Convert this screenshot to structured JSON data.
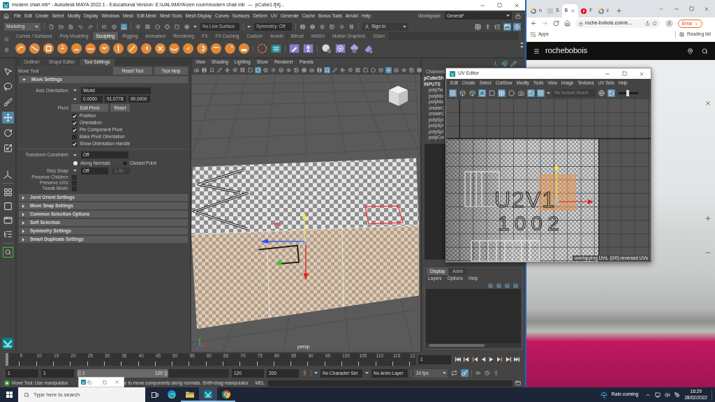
{
  "maya": {
    "title": "modern chair.mb* - Autodesk MAYA 2022.1 - Educational Version: E:\\UAL\\MAYA\\zen room\\modern chair.mb  ---  pCube1.f[4]...",
    "menus": [
      "File",
      "Edit",
      "Create",
      "Select",
      "Modify",
      "Display",
      "Windows",
      "Mesh",
      "Edit Mesh",
      "Mesh Tools",
      "Mesh Display",
      "Curves",
      "Surfaces",
      "Deform",
      "UV",
      "Generate",
      "Cache",
      "Bonus Tools",
      "Arnold",
      "Help"
    ],
    "workspace": {
      "label": "Workspace:",
      "value": "General*"
    },
    "status_line": {
      "mode": "Modeling",
      "select_modes": [
        {
          "selected": false
        },
        {
          "selected": false
        },
        {
          "selected": true
        }
      ],
      "live_surface": "No Live Surface",
      "symmetry": "Symmetry: Off",
      "sign_in": "Sign In",
      "panel_toggles": [
        {
          "on": false
        },
        {
          "on": false
        },
        {
          "on": false
        },
        {
          "on": true
        },
        {
          "on": true
        }
      ]
    },
    "shelf_tabs": [
      {
        "label": "Curves / Surfaces",
        "selected": false
      },
      {
        "label": "Poly Modeling",
        "selected": false
      },
      {
        "label": "Sculpting",
        "selected": true
      },
      {
        "label": "Rigging",
        "selected": false
      },
      {
        "label": "Animation",
        "selected": false
      },
      {
        "label": "Rendering",
        "selected": false
      },
      {
        "label": "FX",
        "selected": false
      },
      {
        "label": "FX Caching",
        "selected": false
      },
      {
        "label": "Custom",
        "selected": false
      },
      {
        "label": "Arnold",
        "selected": false
      },
      {
        "label": "Bifrost",
        "selected": false
      },
      {
        "label": "MASH",
        "selected": false
      },
      {
        "label": "Motion Graphics",
        "selected": false
      },
      {
        "label": "XGen",
        "selected": false
      }
    ],
    "toolbox": [
      {
        "selected": false
      },
      {
        "selected": false
      },
      {
        "selected": false
      },
      {
        "selected": true
      },
      {
        "selected": false
      },
      {
        "selected": false
      }
    ],
    "tool_settings": {
      "tabs": [
        {
          "label": "Outliner",
          "selected": false
        },
        {
          "label": "Shape Editor",
          "selected": false
        },
        {
          "label": "Tool Settings",
          "selected": true
        }
      ],
      "tool_name": "Move Tool",
      "buttons": [
        "Reset Tool",
        "Tool Help"
      ],
      "sections": [
        {
          "title": "Move Settings",
          "expanded": true
        },
        {
          "title": "Joint Orient Settings",
          "expanded": false
        },
        {
          "title": "Move Snap Settings",
          "expanded": false
        },
        {
          "title": "Common Selection Options",
          "expanded": false
        },
        {
          "title": "Soft Selection",
          "expanded": false
        },
        {
          "title": "Symmetry Settings",
          "expanded": false
        },
        {
          "title": "Smart Duplicate Settings",
          "expanded": false
        }
      ],
      "axis_orientation": {
        "label": "Axis Orientation:",
        "value": "World",
        "values": [
          "0.0000",
          "91.0778",
          "90.0000"
        ]
      },
      "pivot": {
        "label": "Pivot:",
        "buttons": [
          "Edit Pivot",
          "Reset"
        ]
      },
      "pivot_options": [
        {
          "label": "Position",
          "checked": true
        },
        {
          "label": "Orientation",
          "checked": true
        },
        {
          "label": "Pin Component Pivot",
          "checked": true
        },
        {
          "label": "Bake Pivot Orientation",
          "checked": false
        },
        {
          "label": "Show Orientation Handle",
          "checked": true
        }
      ],
      "transform_constraint": {
        "label": "Transform Constraint:",
        "value": "Off"
      },
      "constraint_modes": [
        {
          "label": "Along Normals",
          "selected": true
        },
        {
          "label": "Closest Point",
          "selected": false
        }
      ],
      "step_snap": {
        "label": "Step Snap:",
        "value": "Off",
        "amount": "1.00",
        "amount_disabled": true
      },
      "options": [
        {
          "label": "Preserve Children:",
          "checked": false
        },
        {
          "label": "Preserve UVs:",
          "checked": false
        },
        {
          "label": "Tweak Mode:",
          "checked": false
        }
      ]
    },
    "viewport": {
      "menus": [
        "View",
        "Shading",
        "Lighting",
        "Show",
        "Renderer",
        "Panels"
      ],
      "toolbar": [
        {
          "on": false
        },
        {
          "on": false
        },
        {
          "on": false
        },
        {
          "on": false
        },
        {
          "on": false
        },
        {
          "on": false
        },
        {
          "on": false
        },
        {
          "on": false
        },
        {
          "on": true
        },
        {
          "on": false
        },
        {
          "on": false
        },
        {
          "on": false
        },
        {
          "on": false
        },
        {
          "on": false
        },
        {
          "on": false
        },
        {
          "on": false
        },
        {
          "on": false
        },
        {
          "on": true
        },
        {
          "on": false
        },
        {
          "on": false
        },
        {
          "on": false
        },
        {
          "on": false
        },
        {
          "on": false
        },
        {
          "on": false
        },
        {
          "on": false
        },
        {
          "on": true
        },
        {
          "on": false
        },
        {
          "on": false
        },
        {
          "on": false
        },
        {
          "on": false
        }
      ],
      "camera": "persp"
    },
    "channel_box": {
      "title": "Channels",
      "items": [
        {
          "kind": "node",
          "label": "pCubeSh"
        },
        {
          "kind": "heading",
          "label": "INPUTS"
        },
        {
          "kind": "input",
          "label": "polyTw"
        },
        {
          "kind": "input",
          "label": "polyMa"
        },
        {
          "kind": "input",
          "label": "polyMa"
        },
        {
          "kind": "input",
          "label": "createC"
        },
        {
          "kind": "input",
          "label": "createC"
        },
        {
          "kind": "input",
          "label": "polySpl"
        },
        {
          "kind": "input",
          "label": "polySpl"
        },
        {
          "kind": "input",
          "label": "polySpl"
        },
        {
          "kind": "input",
          "label": "polyCut"
        }
      ]
    },
    "layer_editor": {
      "tabs": [
        {
          "label": "Display",
          "selected": true
        },
        {
          "label": "Anim",
          "selected": false
        }
      ],
      "menus": [
        "Layers",
        "Options",
        "Help"
      ]
    },
    "timeline": {
      "ticks": [
        "5",
        "10",
        "15",
        "20",
        "25",
        "30",
        "35",
        "40",
        "45",
        "50",
        "55",
        "60",
        "65",
        "70",
        "75",
        "80",
        "85",
        "90",
        "95",
        "100",
        "105",
        "110",
        "115",
        "12"
      ],
      "current_frame": "1"
    },
    "range": {
      "start": "1",
      "playback_start": "1",
      "slider": {
        "start": "1",
        "end": "120",
        "level": 0.6
      },
      "playback_end": "120",
      "end": "200",
      "character_set": "No Character Set",
      "anim_layer": "No Anim Layer",
      "fps": "24 fps",
      "playback_toggles": [
        {
          "on": false
        },
        {
          "on": true
        }
      ]
    },
    "help_line": {
      "parts": [
        "Move Tool: Use manipulator",
        "e to move components along normals. Shift+drag manipulator"
      ],
      "language": "MEL"
    }
  },
  "uv_editor": {
    "title": "UV Editor",
    "menus": [
      "Edit",
      "Create",
      "Select",
      "Cut/Sew",
      "Modify",
      "Tools",
      "View",
      "Image",
      "Textures",
      "UV Sets",
      "Help"
    ],
    "toolbar": [
      {
        "on": true
      },
      {
        "on": false
      },
      {
        "on": false
      },
      {
        "on": true
      },
      {
        "on": false
      },
      {
        "on": true
      },
      {
        "on": false
      },
      {
        "on": false
      },
      {
        "on": true
      },
      {
        "on": true
      }
    ],
    "texture": "No texture found",
    "display_toggles": [
      {
        "on": false
      },
      {
        "on": true
      }
    ],
    "slider": {
      "level": 0.45
    },
    "tile_labels": [
      "U2V1",
      "1002"
    ],
    "status": "overlapping UVs, (0/0) reversed UVs"
  },
  "browser": {
    "tabs": [
      {
        "kind": "google",
        "label": "n",
        "selected": false
      },
      {
        "kind": "blank",
        "label": "S",
        "selected": false
      },
      {
        "kind": "none",
        "label": "B",
        "selected": true
      },
      {
        "kind": "pinterest",
        "label": "F",
        "selected": false
      },
      {
        "kind": "google",
        "label": "z",
        "selected": false
      }
    ],
    "address": "roche-bobois.com/e...",
    "profile_status": "Error",
    "apps": "Apps",
    "reading_list": "Reading list",
    "logo": "**roche**bobois"
  },
  "taskbar": {
    "search_placeholder": "Type here to search",
    "apps": [
      {
        "kind": "edge",
        "running": false,
        "selected": false
      },
      {
        "kind": "explorer",
        "running": true,
        "selected": false
      },
      {
        "kind": "maya",
        "running": true,
        "selected": true
      },
      {
        "kind": "chrome",
        "running": true,
        "selected": false
      }
    ],
    "weather": "Rain coming",
    "time": "16:29",
    "date": "28/02/2022"
  }
}
